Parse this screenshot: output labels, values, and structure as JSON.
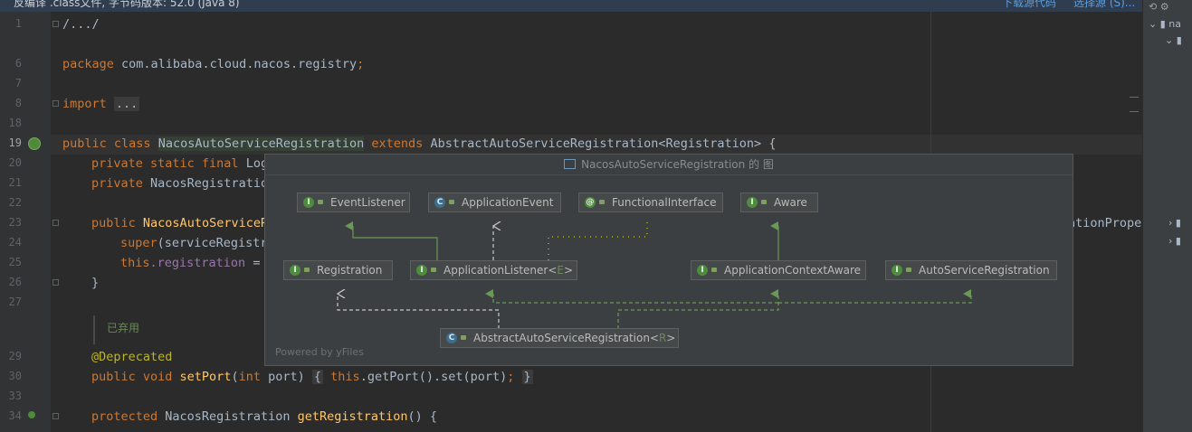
{
  "banner": {
    "text": "反编译 .class文件, 字节码版本: 52.0 (Java 8)",
    "download_link": "下载源代码",
    "choose_link": "选择源 (S)..."
  },
  "gutter": {
    "line_numbers": [
      "1",
      "6",
      "7",
      "8",
      "18",
      "19",
      "20",
      "21",
      "22",
      "23",
      "24",
      "25",
      "26",
      "27",
      "29",
      "30",
      "33",
      "34"
    ]
  },
  "code": {
    "l1": "/.../",
    "l6_kw": "package",
    "l6_rest": " com.alibaba.cloud.nacos.registry",
    "l6_semi": ";",
    "l8_kw": "import",
    "l8_rest": "...",
    "l19_kw": "public class",
    "l19_name": "NacosAutoServiceRegistration",
    "l19_ext": "extends",
    "l19_rest": " AbstractAutoServiceRegistration<Registration> {",
    "l20_kw": "private static final",
    "l20_rest": " Log",
    "l21_kw": "private",
    "l21_rest": " NacosRegistratio",
    "l23_kw": "public",
    "l23_name": "NacosAutoServiceR",
    "l23_right": "ationPrope",
    "l24_kw": "super",
    "l24_rest": "(serviceRegistr",
    "l25_kw": "this",
    "l25_fld": ".registration",
    "l25_rest": " =",
    "l26": "}",
    "deprecated_note": "已弃用",
    "l29_ann": "@Deprecated",
    "l30_kw": "public void",
    "l30_fn": "setPort",
    "l30_a": "(",
    "l30_int": "int",
    "l30_b": " port) ",
    "l30_lb": "{",
    "l30_this": "this",
    "l30_c": ".getPort().set(port)",
    "l30_semi": ";",
    "l30_rb": "}",
    "l34_kw": "protected",
    "l34_type": " NacosRegistration ",
    "l34_fn": "getRegistration",
    "l34_rest": "() {"
  },
  "right_panel": {
    "label": "na"
  },
  "diagram": {
    "title": "NacosAutoServiceRegistration 的 图",
    "powered_by": "Powered by yFiles",
    "nodes": {
      "event_listener": "EventListener",
      "application_event": "ApplicationEvent",
      "functional_interface": "FunctionalInterface",
      "aware": "Aware",
      "registration": "Registration",
      "application_listener": "ApplicationListener<",
      "application_listener_tp": "E",
      "application_listener_end": ">",
      "application_context_aware": "ApplicationContextAware",
      "auto_service_registration": "AutoServiceRegistration",
      "abstract_auto": "AbstractAutoServiceRegistration<",
      "abstract_auto_tp": "R",
      "abstract_auto_end": ">"
    },
    "icon_letters": {
      "interface": "I",
      "class": "C",
      "annotation": "@"
    },
    "colors": {
      "extends_edge": "#6a9955",
      "implements_edge": "#6a9955",
      "dependency_edge": "#c8c8c8",
      "annotation_edge": "#8c9a2a"
    }
  }
}
